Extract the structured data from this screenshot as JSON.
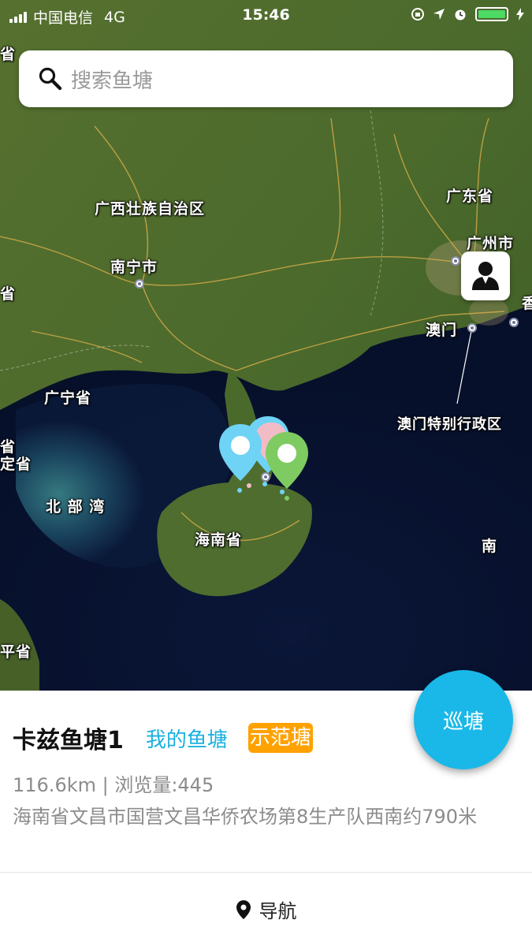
{
  "status_bar": {
    "carrier": "中国电信",
    "network": "4G",
    "time": "15:46",
    "battery_color": "#4cd964"
  },
  "search": {
    "placeholder": "搜索鱼塘",
    "icon": "search-icon"
  },
  "map": {
    "labels": {
      "guangxi": "广西壮族自治区",
      "guangdong": "广东省",
      "guangzhou": "广州市",
      "nanning": "南宁市",
      "macau": "澳门",
      "macau_sar": "澳门特别行政区",
      "province_left": "广宁省",
      "beibu_gulf": "北 部 湾",
      "hainan": "海南省",
      "south": "南",
      "edge_1": "省",
      "edge_2": "省",
      "edge_3": "省",
      "edge_4": "定省",
      "edge_5": "平省",
      "edge_6": "香"
    },
    "pin_colors": [
      "#6fd3f5",
      "#f2bcc7",
      "#6fd3f5",
      "#7ecb62"
    ]
  },
  "user_button": {
    "icon": "user-icon"
  },
  "patrol_button": {
    "label": "巡塘"
  },
  "pond": {
    "name": "卡兹鱼塘1",
    "ownership_tag": "我的鱼塘",
    "demo_badge": "示范塘",
    "stats": "116.6km | 浏览量:445",
    "address": "海南省文昌市国营文昌华侨农场第8生产队西南约790米"
  },
  "navigation": {
    "label": "导航",
    "icon": "location-pin-icon"
  },
  "colors": {
    "accent": "#1ab8e8",
    "badge": "#ffa200",
    "secondary_text": "#8c8c8c"
  }
}
